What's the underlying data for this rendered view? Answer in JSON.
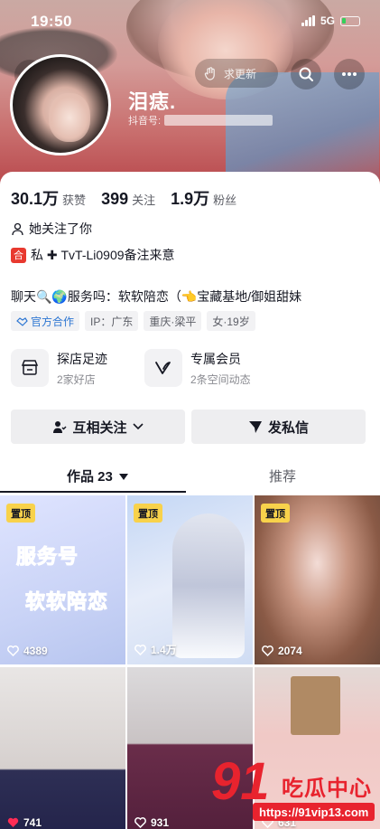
{
  "status_bar": {
    "time": "19:50",
    "network": "5G"
  },
  "top_nav": {
    "update_label": "求更新"
  },
  "profile": {
    "nickname": "泪痣.",
    "douyin_id_label": "抖音号:",
    "stats": [
      {
        "value": "30.1万",
        "label": "获赞"
      },
      {
        "value": "399",
        "label": "关注"
      },
      {
        "value": "1.9万",
        "label": "粉丝"
      }
    ],
    "follows_you": "她关注了你",
    "note_badge": "合",
    "note_text": "私 ✚ TvT-Li0909备注来意",
    "bio": "聊天🔍🌍服务吗：软软陪恋（👈宝藏基地/御姐甜妹",
    "tags": [
      {
        "label": "官方合作",
        "icon": "handshake-icon"
      },
      {
        "label": "IP：广东"
      },
      {
        "label": "重庆·梁平"
      },
      {
        "label": "女·19岁"
      }
    ]
  },
  "features": [
    {
      "title": "探店足迹",
      "subtitle": "2家好店",
      "icon": "shop-icon"
    },
    {
      "title": "专属会员",
      "subtitle": "2条空间动态",
      "icon": "vip-icon"
    }
  ],
  "actions": {
    "mutual_follow": "互相关注",
    "send_message": "发私信"
  },
  "tabs": {
    "works": "作品 23",
    "recommend": "推荐"
  },
  "videos": [
    {
      "pinned": "置顶",
      "likes": "4389",
      "overlay_top": "服务号",
      "overlay_bottom": "软软陪恋"
    },
    {
      "pinned": "置顶",
      "likes": "1.4万"
    },
    {
      "pinned": "置顶",
      "likes": "2074"
    },
    {
      "likes": "741"
    },
    {
      "likes": "931"
    },
    {
      "likes": "631"
    }
  ],
  "watermark": {
    "logo": "91",
    "name": "吃瓜中心",
    "url": "https://91vip13.com"
  },
  "colors": {
    "accent_red": "#e8232e",
    "pin_yellow": "#f8d24b",
    "official_blue": "#2d76d2"
  }
}
